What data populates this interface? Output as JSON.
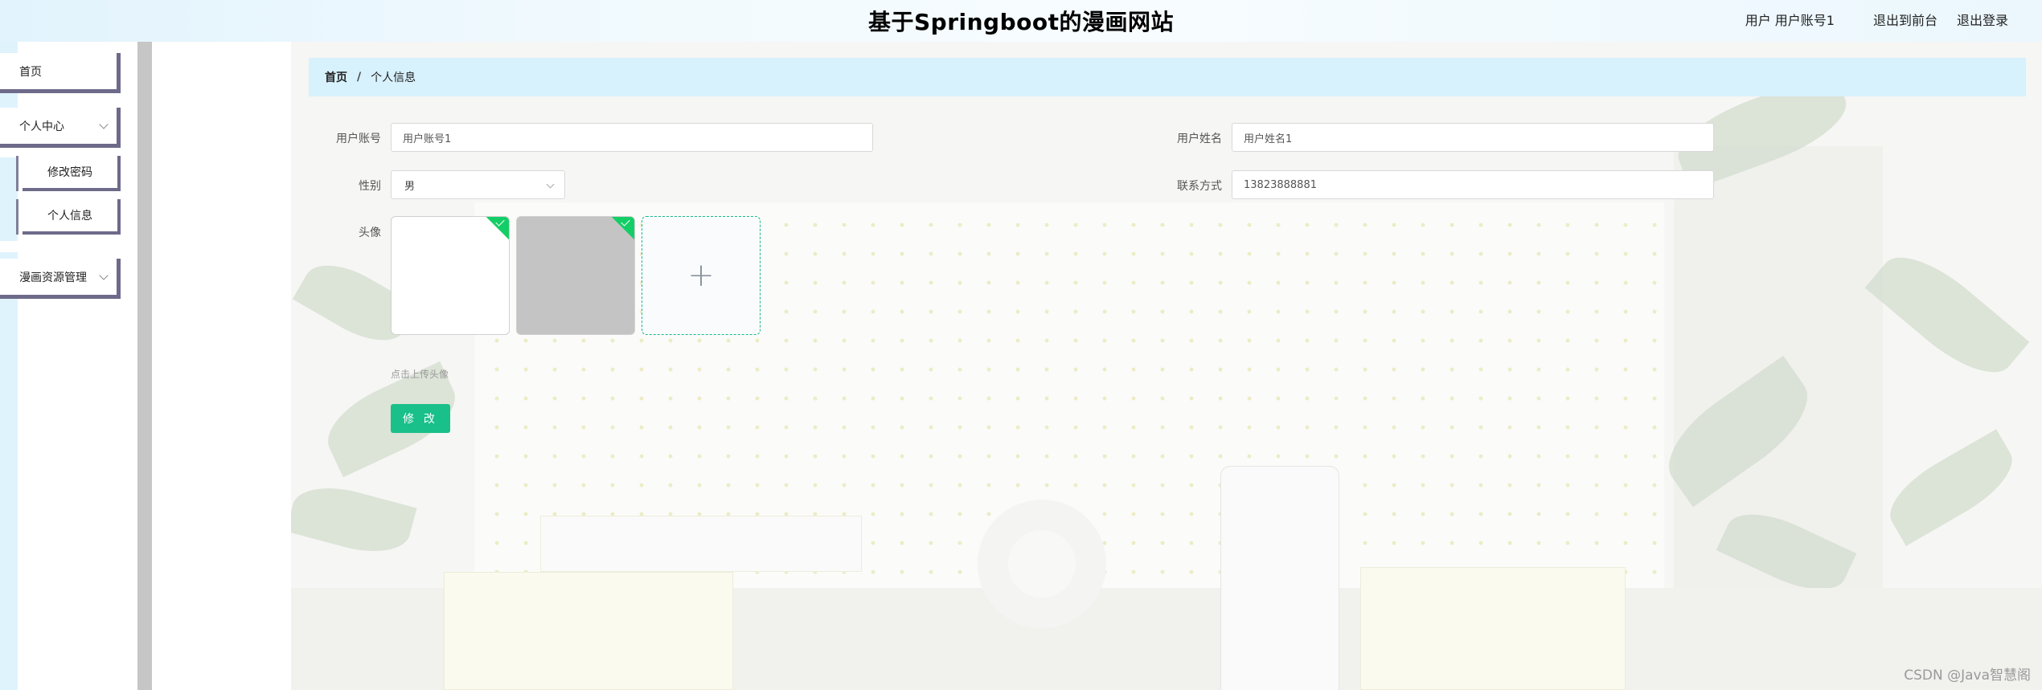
{
  "header": {
    "title": "基于Springboot的漫画网站",
    "user_text": "用户 用户账号1",
    "links": [
      "退出到前台",
      "退出登录"
    ]
  },
  "sidebar": {
    "home": "首页",
    "personal_center": "个人中心",
    "change_password": "修改密码",
    "personal_info": "个人信息",
    "comic_management": "漫画资源管理"
  },
  "breadcrumb": {
    "home": "首页",
    "separator": "/",
    "current": "个人信息"
  },
  "form": {
    "account_label": "用户账号",
    "account_value": "用户账号1",
    "name_label": "用户姓名",
    "name_value": "用户姓名1",
    "gender_label": "性别",
    "gender_value": "男",
    "contact_label": "联系方式",
    "contact_value": "13823888881",
    "avatar_label": "头像",
    "upload_hint": "点击上传头像",
    "submit_label": "修 改",
    "add_icon": "+"
  },
  "colors": {
    "accent": "#19c08a",
    "breadcrumb_bg": "#d7f1fd",
    "sidebar_border": "#6d6a8a"
  },
  "watermark": "CSDN @Java智慧阁"
}
